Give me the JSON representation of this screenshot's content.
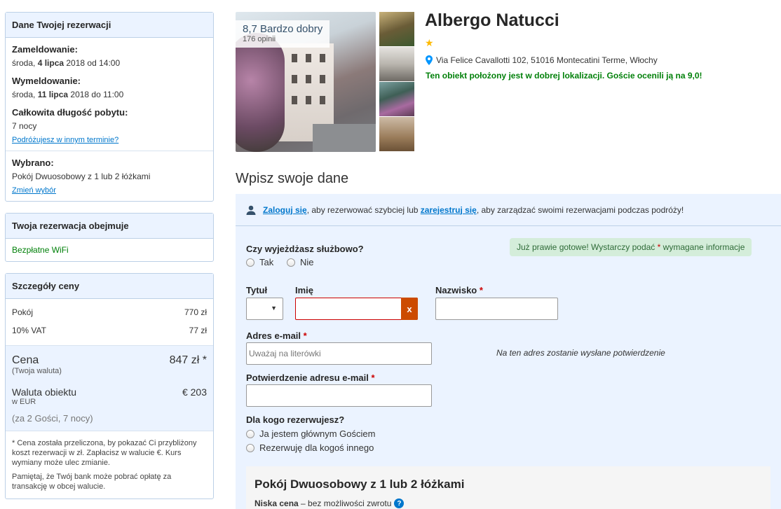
{
  "reservation": {
    "header": "Dane Twojej rezerwacji",
    "checkin_label": "Zameldowanie:",
    "checkin_day": "środa, ",
    "checkin_date": "4 lipca",
    "checkin_rest": " 2018 od 14:00",
    "checkout_label": "Wymeldowanie:",
    "checkout_day": "środa, ",
    "checkout_date": "11 lipca",
    "checkout_rest": " 2018 do 11:00",
    "length_label": "Całkowita długość pobytu:",
    "length_value": "7 nocy",
    "change_dates_link": "Podróżujesz w innym terminie?",
    "selected_label": "Wybrano:",
    "selected_value": "Pokój Dwuosobowy z 1 lub 2 łóżkami",
    "change_selection_link": "Zmień wybór"
  },
  "includes": {
    "header": "Twoja rezerwacja obejmuje",
    "item": "Bezpłatne WiFi"
  },
  "price": {
    "header": "Szczegóły ceny",
    "rows": [
      {
        "label": "Pokój",
        "value": "770 zł"
      },
      {
        "label": "10% VAT",
        "value": "77 zł"
      }
    ],
    "total_label": "Cena",
    "total_value": "847 zł *",
    "total_sub": "(Twoja waluta)",
    "property_currency_label": "Waluta obiektu",
    "property_currency_value": "€ 203",
    "property_currency_sub": "w EUR",
    "guests_note": "(za 2 Gości, 7 nocy)",
    "footnote_1": "* Cena została przeliczona, by pokazać Ci przybliżony koszt rezerwacji w zł. Zapłacisz w walucie €. Kurs wymiany może ulec zmianie.",
    "footnote_2": "Pamiętaj, że Twój bank może pobrać opłatę za transakcję w obcej walucie."
  },
  "hotel": {
    "rating_score": "8,7 Bardzo dobry",
    "rating_reviews": "176 opinii",
    "name": "Albergo Natucci",
    "stars": "★",
    "address": "Via Felice Cavallotti 102, 51016 Montecatini Terme, Włochy",
    "location_note": "Ten obiekt położony jest w dobrej lokalizacji. Goście ocenili ją na 9,0!"
  },
  "form": {
    "section_title": "Wpisz swoje dane",
    "login_link": "Zaloguj się",
    "login_middle": ", aby rezerwować szybciej lub ",
    "register_link": "zarejestruj się",
    "login_end": ", aby zarządzać swoimi rezerwacjami podczas podróży!",
    "business_question": "Czy wyjeżdżasz służbowo?",
    "business_yes": "Tak",
    "business_no": "Nie",
    "hint_pre": "Już prawie gotowe! Wystarczy podać ",
    "hint_star": "*",
    "hint_post": " wymagane informacje",
    "title_label": "Tytuł",
    "first_name_label": "Imię",
    "last_name_label": "Nazwisko",
    "required_mark": "*",
    "error_mark": "x",
    "email_label": "Adres e-mail",
    "email_placeholder": "Uważaj na literówki",
    "email_note": "Na ten adres zostanie wysłane potwierdzenie",
    "email_confirm_label": "Potwierdzenie adresu e-mail",
    "for_whom_label": "Dla kogo rezerwujesz?",
    "for_whom_self": "Ja jestem głównym Gościem",
    "for_whom_other": "Rezerwuję dla kogoś innego"
  },
  "room": {
    "title": "Pokój Dwuosobowy z 1 lub 2 łóżkami",
    "price_type": "Niska cena",
    "price_note": " – bez możliwości zwrotu",
    "help": "?"
  },
  "colors": {
    "link": "#0077cc",
    "green": "#008009",
    "panel_bg": "#ebf3ff",
    "star": "#feba02",
    "error": "#cc0000"
  }
}
